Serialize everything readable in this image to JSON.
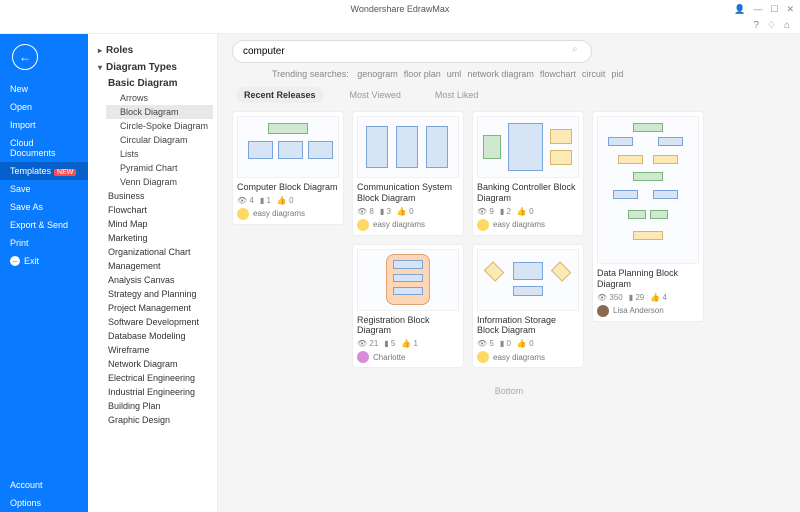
{
  "title": "Wondershare EdrawMax",
  "sidebar": {
    "items": [
      "New",
      "Open",
      "Import",
      "Cloud Documents"
    ],
    "templates": "Templates",
    "templates_badge": "NEW",
    "items2": [
      "Save",
      "Save As",
      "Export & Send",
      "Print"
    ],
    "exit": "Exit",
    "bottom": [
      "Account",
      "Options"
    ]
  },
  "tree": {
    "roles": "Roles",
    "section": "Diagram Types",
    "basic": "Basic Diagram",
    "basic_items": [
      "Arrows",
      "Block Diagram",
      "Circle-Spoke Diagram",
      "Circular Diagram",
      "Lists",
      "Pyramid Chart",
      "Venn Diagram"
    ],
    "cats": [
      "Business",
      "Flowchart",
      "Mind Map",
      "Marketing",
      "Organizational Chart",
      "Management",
      "Analysis Canvas",
      "Strategy and Planning",
      "Project Management",
      "Software Development",
      "Database Modeling",
      "Wireframe",
      "Network Diagram",
      "Electrical Engineering",
      "Industrial Engineering",
      "Building Plan",
      "Graphic Design"
    ]
  },
  "search": {
    "value": "computer"
  },
  "trending": {
    "label": "Trending searches:",
    "items": [
      "genogram",
      "floor plan",
      "uml",
      "network diagram",
      "flowchart",
      "circuit",
      "pid"
    ]
  },
  "tabs": [
    "Recent Releases",
    "Most Viewed",
    "Most Liked"
  ],
  "cards": [
    {
      "title": "Computer Block Diagram",
      "views": "4",
      "copies": "1",
      "likes": "0",
      "author": "easy diagrams",
      "avatar": ""
    },
    {
      "title": "Communication System Block Diagram",
      "views": "8",
      "copies": "3",
      "likes": "0",
      "author": "easy diagrams",
      "avatar": ""
    },
    {
      "title": "Banking Controller Block Diagram",
      "views": "9",
      "copies": "2",
      "likes": "0",
      "author": "easy diagrams",
      "avatar": ""
    },
    {
      "title": "Data Planning Block Diagram",
      "views": "350",
      "copies": "29",
      "likes": "4",
      "author": "Lisa Anderson",
      "avatar": "br",
      "tall": true
    },
    {
      "title": "Registration Block Diagram",
      "views": "21",
      "copies": "5",
      "likes": "1",
      "author": "Charlotte",
      "avatar": "p"
    },
    {
      "title": "Information Storage Block Diagram",
      "views": "5",
      "copies": "0",
      "likes": "0",
      "author": "easy diagrams",
      "avatar": ""
    }
  ],
  "bottom": "Bottom"
}
